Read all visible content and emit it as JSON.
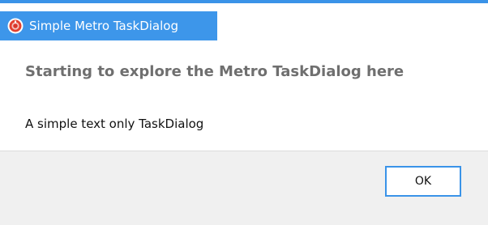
{
  "window": {
    "title": "Simple Metro TaskDialog",
    "accent_color": "#3d96ea",
    "icon": "app-logo-icon"
  },
  "dialog": {
    "main_instruction": "Starting to explore the Metro TaskDialog here",
    "content": "A simple text only TaskDialog"
  },
  "buttons": {
    "ok_label": "OK"
  }
}
